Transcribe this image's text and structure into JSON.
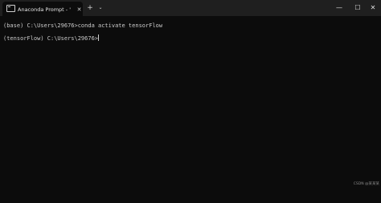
{
  "window": {
    "tab_title": "Anaconda Prompt - \"C:\\Progr",
    "tab_close": "✕",
    "new_tab": "+",
    "tab_dropdown": "⌄",
    "minimize": "—",
    "maximize": "☐",
    "close": "✕"
  },
  "terminal": {
    "lines": [
      "(base) C:\\Users\\29676>conda activate tensorFlow",
      "(tensorFlow) C:\\Users\\29676>"
    ]
  },
  "watermark": "CSDN @某某某",
  "icons": {
    "tab": "terminal-icon",
    "cursor": "text-cursor"
  },
  "colors": {
    "background": "#0c0c0c",
    "titlebar": "#1f1f1f",
    "text": "#cccccc"
  }
}
